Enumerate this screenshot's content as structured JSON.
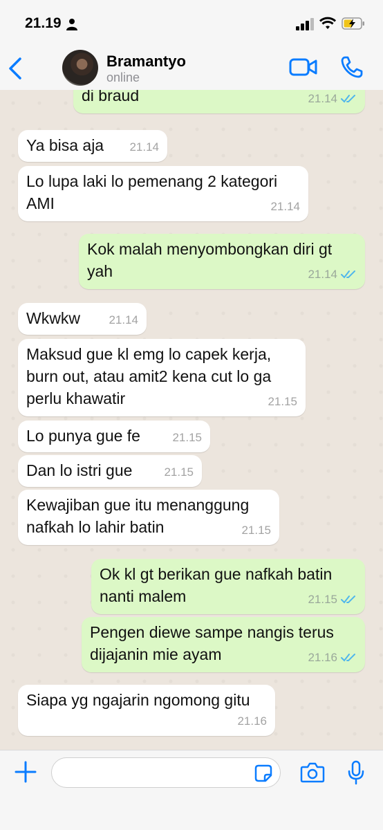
{
  "status_bar": {
    "time": "21.19"
  },
  "header": {
    "contact_name": "Bramantyo",
    "presence": "online"
  },
  "colors": {
    "accent": "#0a7cff",
    "incoming": "#ffffff",
    "outgoing": "#dcf8c6",
    "chat_bg": "#ece5dd",
    "read_ticks": "#4fb6ec"
  },
  "messages": [
    {
      "dir": "out",
      "text": "di braud",
      "time": "21.14",
      "read": true
    },
    {
      "dir": "in",
      "text": "Ya bisa aja",
      "time": "21.14"
    },
    {
      "dir": "in",
      "text": "Lo lupa laki lo pemenang 2 kategori\nAMI",
      "time": "21.14"
    },
    {
      "dir": "out",
      "text": "Kok malah menyombongkan diri gt\nyah",
      "time": "21.14",
      "read": true
    },
    {
      "dir": "in",
      "text": "Wkwkw",
      "time": "21.14"
    },
    {
      "dir": "in",
      "text": "Maksud gue kl emg lo capek kerja,\nburn out, atau amit2 kena cut lo ga\nperlu khawatir",
      "time": "21.15"
    },
    {
      "dir": "in",
      "text": "Lo punya gue fe",
      "time": "21.15"
    },
    {
      "dir": "in",
      "text": "Dan lo istri gue",
      "time": "21.15"
    },
    {
      "dir": "in",
      "text": "Kewajiban gue itu menanggung\nnafkah lo lahir batin",
      "time": "21.15"
    },
    {
      "dir": "out",
      "text": "Ok kl gt berikan gue nafkah batin\nnanti malem",
      "time": "21.15",
      "read": true
    },
    {
      "dir": "out",
      "text": "Pengen diewe sampe nangis terus\ndijajanin mie ayam",
      "time": "21.16",
      "read": true
    },
    {
      "dir": "in",
      "text": "Siapa yg ngajarin ngomong gitu",
      "time": "21.16"
    }
  ],
  "icons": [
    "back-chevron-icon",
    "video-call-icon",
    "phone-call-icon",
    "plus-icon",
    "sticker-icon",
    "camera-icon",
    "microphone-icon"
  ]
}
